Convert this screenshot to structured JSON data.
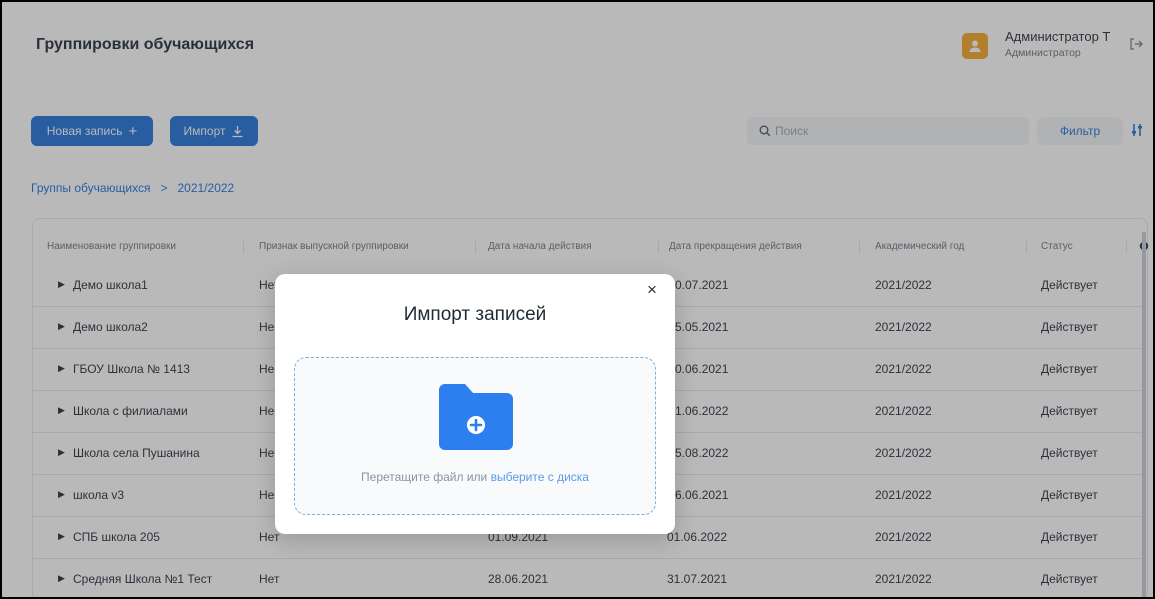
{
  "header": {
    "title": "Группировки обучающихся",
    "user_name": "Администратор Т",
    "user_role": "Администратор"
  },
  "toolbar": {
    "new_record_label": "Новая запись",
    "import_label": "Импорт",
    "search_placeholder": "Поиск",
    "filter_label": "Фильтр"
  },
  "breadcrumb": {
    "root": "Группы обучающихся",
    "separator": ">",
    "current": "2021/2022"
  },
  "table": {
    "columns": [
      "Наименование группировки",
      "Признак выпускной группировки",
      "Дата начала действия",
      "Дата прекращения действия",
      "Академический год",
      "Статус"
    ],
    "rows": [
      {
        "name": "Демо школа1",
        "graduate": "Нет",
        "start": "",
        "end": "0.07.2021",
        "year": "2021/2022",
        "status": "Действует"
      },
      {
        "name": "Демо школа2",
        "graduate": "Не",
        "start": "",
        "end": "5.05.2021",
        "year": "2021/2022",
        "status": "Действует"
      },
      {
        "name": "ГБОУ Школа № 1413",
        "graduate": "Не",
        "start": "",
        "end": "0.06.2021",
        "year": "2021/2022",
        "status": "Действует"
      },
      {
        "name": "Школа с филиалами",
        "graduate": "Не",
        "start": "",
        "end": "1.06.2022",
        "year": "2021/2022",
        "status": "Действует"
      },
      {
        "name": "Школа села Пушанина",
        "graduate": "Не",
        "start": "",
        "end": "5.08.2022",
        "year": "2021/2022",
        "status": "Действует"
      },
      {
        "name": "школа v3",
        "graduate": "Не",
        "start": "",
        "end": "6.06.2021",
        "year": "2021/2022",
        "status": "Действует"
      },
      {
        "name": "СПБ школа 205",
        "graduate": "Нет",
        "start": "01.09.2021",
        "end": "01.06.2022",
        "year": "2021/2022",
        "status": "Действует"
      },
      {
        "name": "Средняя Школа №1 Тест",
        "graduate": "Нет",
        "start": "28.06.2021",
        "end": "31.07.2021",
        "year": "2021/2022",
        "status": "Действует"
      }
    ]
  },
  "modal": {
    "title": "Импорт записей",
    "close_symbol": "×",
    "drop_text": "Перетащите файл или",
    "drop_link": "выберите с диска"
  },
  "colors": {
    "accent": "#1e6fd9",
    "avatar": "#f5a623",
    "folder": "#2d7ff0",
    "link": "#5b9ae8"
  }
}
